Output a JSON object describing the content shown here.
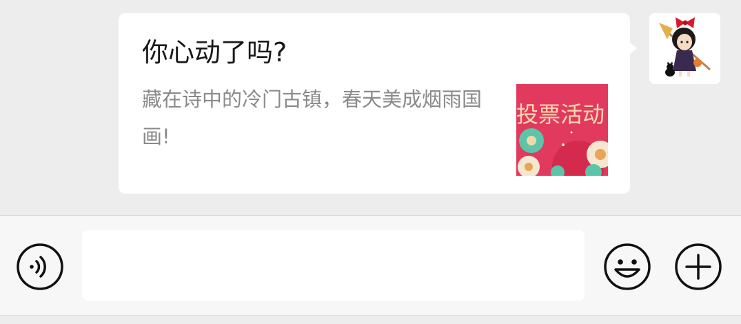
{
  "message": {
    "card": {
      "title": "你心动了吗?",
      "description": "藏在诗中的冷门古镇，春天美成烟雨国画!",
      "thumbnail_text": "投票活动"
    },
    "sender_avatar": "girl-with-red-bow-broom-cat-avatar"
  },
  "input_bar": {
    "voice_icon": "voice-icon",
    "text_value": "",
    "emoji_icon": "smiley-icon",
    "more_icon": "plus-icon"
  },
  "colors": {
    "chat_background": "#ededed",
    "bubble": "#ffffff",
    "thumbnail_red": "#e23a5e",
    "description_gray": "#8a8a8a"
  }
}
